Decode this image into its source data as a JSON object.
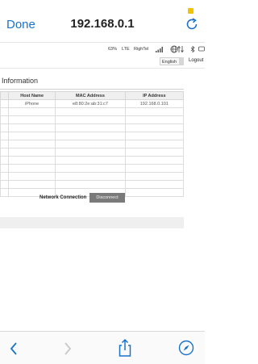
{
  "browser": {
    "done_label": "Done",
    "url": "192.168.0.1"
  },
  "status": {
    "battery": "63%",
    "network": "LTE",
    "carrier": "RighTel"
  },
  "header": {
    "language": "English",
    "logout_label": "Logout"
  },
  "section": {
    "title": "Information"
  },
  "table": {
    "headers": [
      "Host Name",
      "MAC Address",
      "IP Address"
    ],
    "rows": [
      [
        "iPhone",
        "e8:80:2e:ab:31:c7",
        "192.168.0.101"
      ],
      [
        "",
        "",
        ""
      ],
      [
        "",
        "",
        ""
      ],
      [
        "",
        "",
        ""
      ],
      [
        "",
        "",
        ""
      ],
      [
        "",
        "",
        ""
      ],
      [
        "",
        "",
        ""
      ],
      [
        "",
        "",
        ""
      ],
      [
        "",
        "",
        ""
      ],
      [
        "",
        "",
        ""
      ],
      [
        "",
        "",
        ""
      ],
      [
        "",
        "",
        ""
      ]
    ]
  },
  "connection": {
    "label": "Network Connection",
    "button_label": "Disconnect"
  },
  "colors": {
    "accent": "#1a73c9",
    "button": "#7a7a7a"
  }
}
